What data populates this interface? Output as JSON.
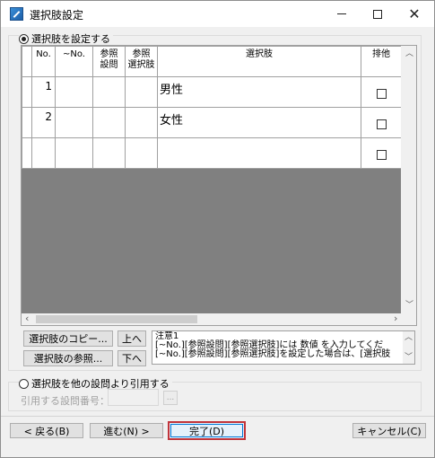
{
  "window": {
    "title": "選択肢設定"
  },
  "group1": {
    "radio_label": "選択肢を設定する",
    "selected": true
  },
  "grid": {
    "headers": {
      "no": "No.",
      "to_no": "~No.",
      "ref_question": "参照\n設問",
      "ref_choice": "参照\n選択肢",
      "choice": "選択肢",
      "exclusive": "排他"
    },
    "rows": [
      {
        "no": "1",
        "to_no": "",
        "ref_question": "",
        "ref_choice": "",
        "choice": "男性",
        "exclusive": false
      },
      {
        "no": "2",
        "to_no": "",
        "ref_question": "",
        "ref_choice": "",
        "choice": "女性",
        "exclusive": false
      },
      {
        "no": "",
        "to_no": "",
        "ref_question": "",
        "ref_choice": "",
        "choice": "",
        "exclusive": false
      }
    ]
  },
  "buttons": {
    "copy_choices": "選択肢のコピー...",
    "up": "上へ",
    "ref_choices": "選択肢の参照...",
    "down": "下へ",
    "browse": "...",
    "back": "< 戻る(B)",
    "next": "進む(N) >",
    "finish": "完了(D)",
    "cancel": "キャンセル(C)"
  },
  "note": {
    "title": "注意1",
    "line1": "[~No.][参照設問][参照選択肢]には 数値 を入力してくだ",
    "line2": "[~No.][参照設問][参照選択肢]を設定した場合は、[選択肢"
  },
  "group2": {
    "radio_label": "選択肢を他の設問より引用する",
    "selected": false,
    "ref_question_label": "引用する設問番号：",
    "ref_question_value": ""
  }
}
